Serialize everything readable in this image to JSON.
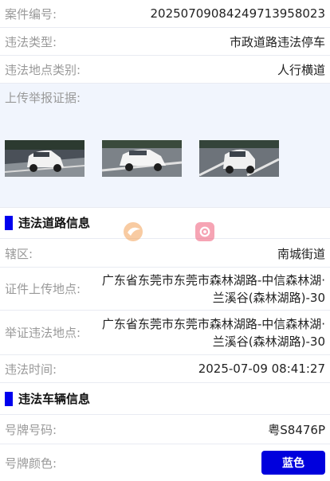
{
  "case": {
    "label": "案件编号:",
    "value": "20250709084249713958023"
  },
  "violation_type": {
    "label": "违法类型:",
    "value": "市政道路违法停车"
  },
  "location_type": {
    "label": "违法地点类别:",
    "value": "人行横道"
  },
  "evidence": {
    "label": "上传举报证据:",
    "photo_count": 3
  },
  "road_section": {
    "title": "违法道路信息"
  },
  "district": {
    "label": "辖区:",
    "value": "南城街道"
  },
  "upload_place": {
    "label": "证件上传地点:",
    "value": "广东省东莞市东莞市森林湖路-中信森林湖·兰溪谷(森林湖路)-30"
  },
  "violation_place": {
    "label": "举证违法地点:",
    "value": "广东省东莞市东莞市森林湖路-中信森林湖·兰溪谷(森林湖路)-30"
  },
  "violation_time": {
    "label": "违法时间:",
    "value": "2025-07-09 08:41:27"
  },
  "vehicle_section": {
    "title": "违法车辆信息"
  },
  "plate_number": {
    "label": "号牌号码:",
    "value": "粤S8476P"
  },
  "plate_color": {
    "label": "号牌颜色:",
    "value": "蓝色",
    "color": "#0000dd"
  },
  "colors": {
    "accent": "#0000ee",
    "label": "#999999",
    "text": "#222222",
    "evidence_bg": "#f1f5fd"
  }
}
